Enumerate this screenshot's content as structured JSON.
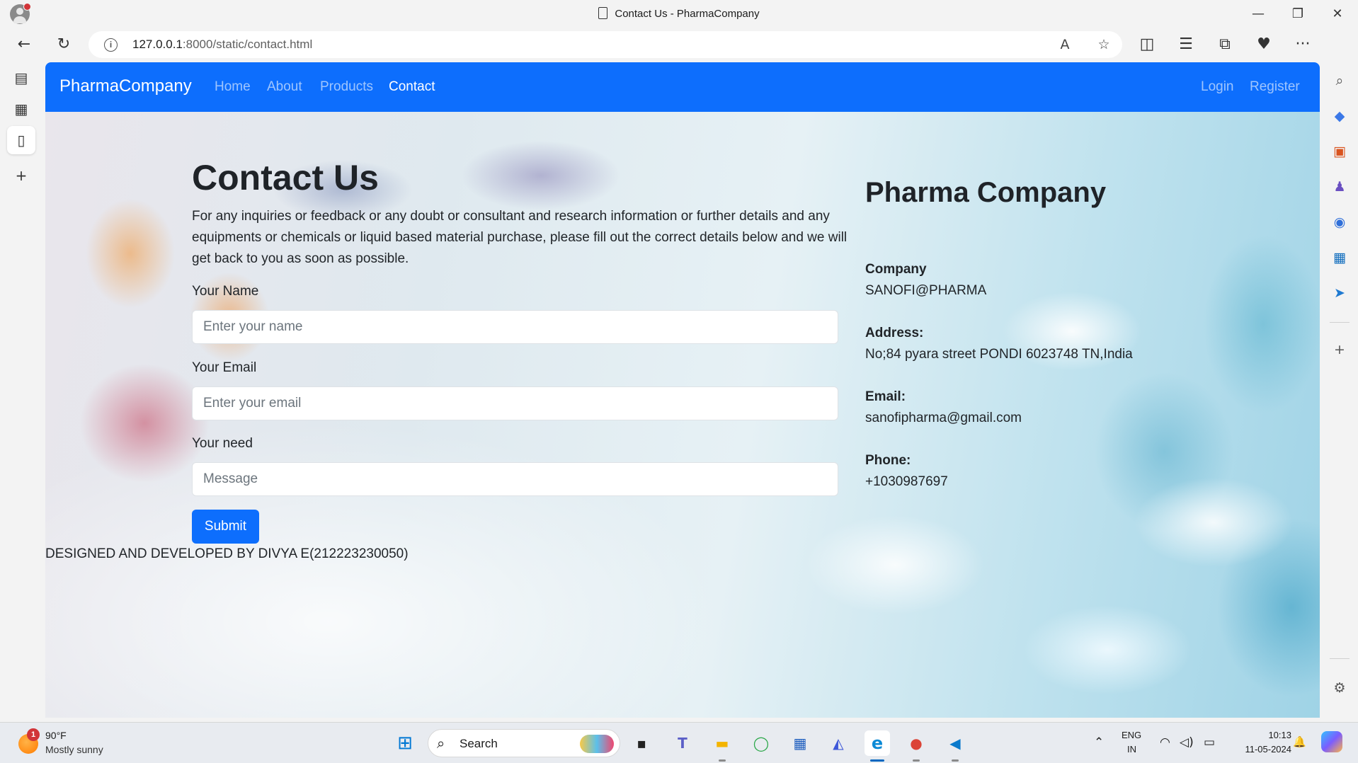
{
  "window": {
    "title": "Contact Us - PharmaCompany",
    "minimize_glyph": "—",
    "restore_glyph": "❐",
    "close_glyph": "✕"
  },
  "toolbar": {
    "back_glyph": "←",
    "refresh_glyph": "↻",
    "url_host": "127.0.0.1",
    "url_rest": ":8000/static/contact.html",
    "read_aloud_glyph": "A",
    "favorite_glyph": "☆",
    "split_glyph": "◫",
    "favorites_glyph": "☰",
    "collections_glyph": "⧉",
    "health_glyph": "♥",
    "more_glyph": "···",
    "copilot_glyph": "✦"
  },
  "left_strip": {
    "tab_actions_glyph": "▤",
    "history_glyph": "▦",
    "page_glyph": "▯",
    "new_tab_glyph": "+"
  },
  "right_sidebar": {
    "search_glyph": "⌕",
    "tag_glyph": "◆",
    "tools_glyph": "▣",
    "games_glyph": "♟",
    "office_glyph": "◉",
    "outlook_glyph": "▦",
    "send_glyph": "➤",
    "add_glyph": "+",
    "settings_glyph": "⚙"
  },
  "navbar": {
    "brand": "PharmaCompany",
    "links": [
      "Home",
      "About",
      "Products",
      "Contact"
    ],
    "active_link": "Contact",
    "right_links": [
      "Login",
      "Register"
    ]
  },
  "contact": {
    "heading": "Contact Us",
    "lead": "For any inquiries or feedback or any doubt or consultant and research information or further details and any equipments or chemicals or liquid based material purchase, please fill out the correct details below and we will get back to you as soon as possible.",
    "name_label": "Your Name",
    "name_placeholder": "Enter your name",
    "name_value": "",
    "email_label": "Your Email",
    "email_placeholder": "Enter your email",
    "email_value": "",
    "need_label": "Your need",
    "need_placeholder": "Message",
    "need_value": "",
    "submit_label": "Submit"
  },
  "company_info": {
    "heading": "Pharma Company",
    "company_label": "Company",
    "company_value": "SANOFI@PHARMA",
    "address_label": "Address:",
    "address_value": "No;84 pyara street PONDI 6023748 TN,India",
    "email_label": "Email:",
    "email_value": "sanofipharma@gmail.com",
    "phone_label": "Phone:",
    "phone_value": "+1030987697"
  },
  "footer": {
    "text": "DESIGNED AND DEVELOPED BY DIVYA E(212223230050)"
  },
  "taskbar": {
    "weather_badge": "1",
    "temperature": "90°F",
    "condition": "Mostly sunny",
    "search_label": "Search",
    "search_glyph": "⌕",
    "app_glyphs": {
      "start": "⊞",
      "task_view": "▪",
      "teams": "T",
      "explorer": "▬",
      "ring": "◯",
      "store": "▦",
      "copilot": "◭",
      "edge": "e",
      "chrome": "●",
      "vscode": "◀"
    },
    "tray_chevron": "⌃",
    "language_top": "ENG",
    "language_bottom": "IN",
    "wifi_glyph": "◠",
    "volume_glyph": "◁)",
    "battery_glyph": "▭",
    "time": "10:13",
    "date": "11-05-2024",
    "bell_glyph": "🔔"
  },
  "colors": {
    "navbar": "#0d6efd",
    "primary_button": "#0d6efd",
    "chrome": "#f3f3f3"
  }
}
